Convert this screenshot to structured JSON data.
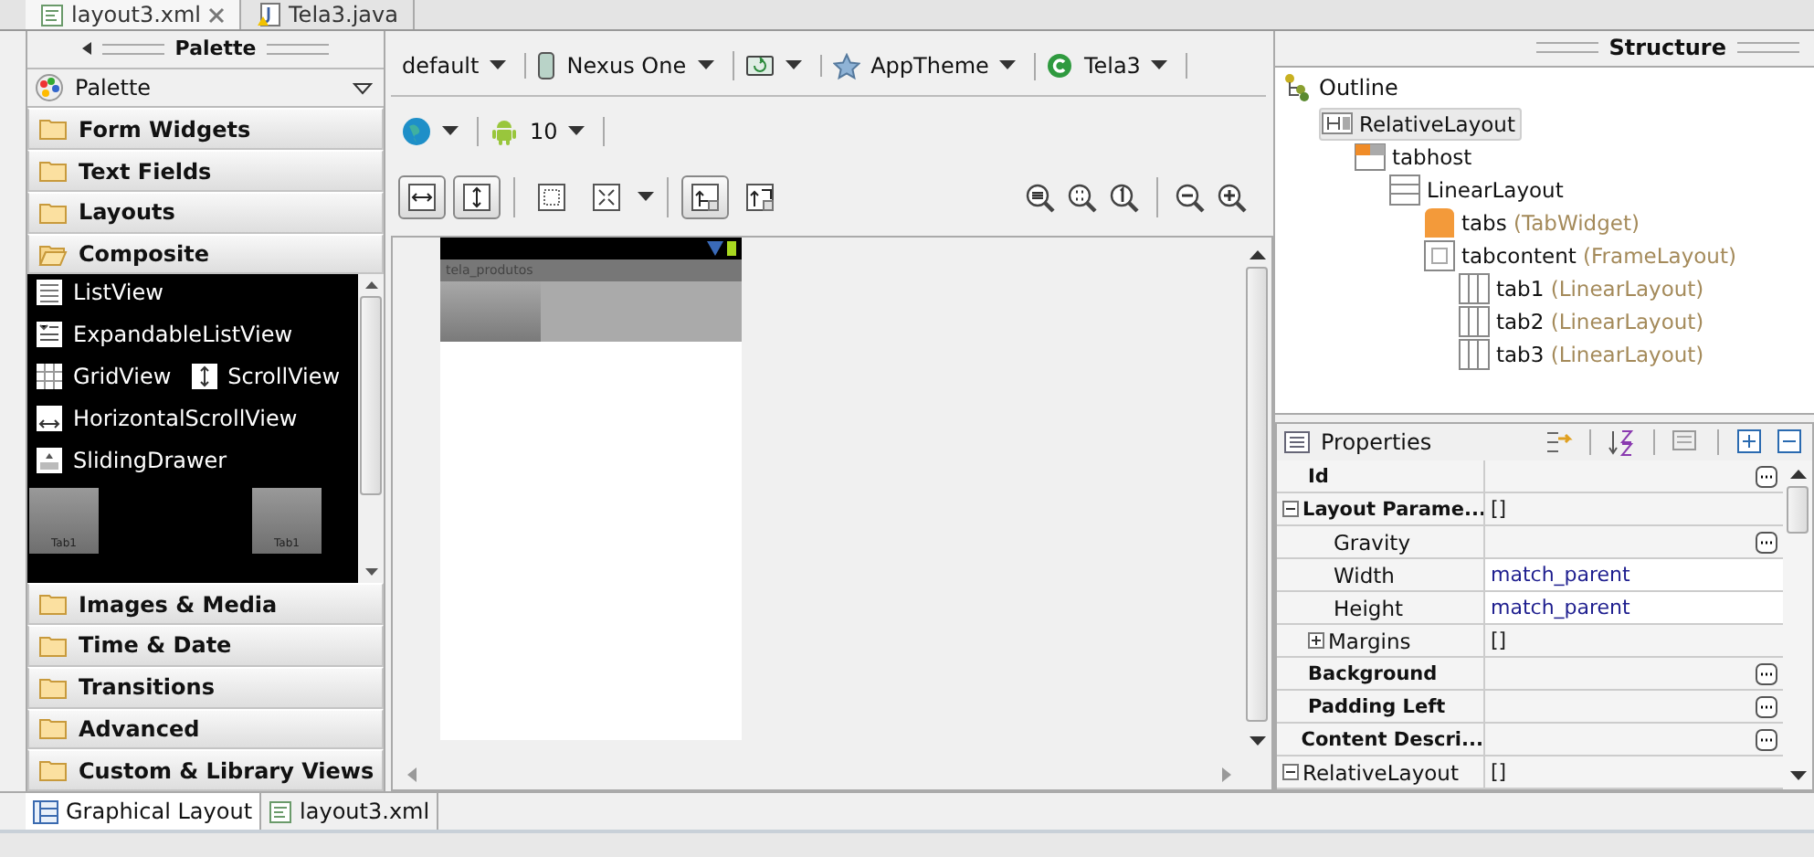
{
  "editor_tabs": [
    {
      "label": "layout3.xml",
      "selected": true,
      "kind": "xml"
    },
    {
      "label": "Tela3.java",
      "selected": false,
      "kind": "java"
    }
  ],
  "palette": {
    "title": "Palette",
    "dropdown": "Palette",
    "categories": [
      {
        "label": "Form Widgets",
        "expanded": false
      },
      {
        "label": "Text Fields",
        "expanded": false
      },
      {
        "label": "Layouts",
        "expanded": false
      },
      {
        "label": "Composite",
        "expanded": true,
        "widget_rows": [
          [
            {
              "label": "ListView",
              "kind": "list"
            }
          ],
          [
            {
              "label": "ExpandableListView",
              "kind": "expandable"
            }
          ],
          [
            {
              "label": "GridView",
              "kind": "grid"
            },
            {
              "label": "ScrollView",
              "kind": "vscroll"
            }
          ],
          [
            {
              "label": "HorizontalScrollView",
              "kind": "hscroll"
            }
          ],
          [
            {
              "label": "SlidingDrawer",
              "kind": "drawer"
            }
          ]
        ],
        "tab_preview": [
          "Tab1",
          "Tab1"
        ]
      },
      {
        "label": "Images & Media",
        "expanded": false
      },
      {
        "label": "Time & Date",
        "expanded": false
      },
      {
        "label": "Transitions",
        "expanded": false
      },
      {
        "label": "Advanced",
        "expanded": false
      },
      {
        "label": "Custom & Library Views",
        "expanded": false
      }
    ]
  },
  "config_bar": [
    {
      "kind": "text",
      "label": "default"
    },
    {
      "kind": "device",
      "label": "Nexus One"
    },
    {
      "kind": "orientation"
    },
    {
      "kind": "theme",
      "label": "AppTheme"
    },
    {
      "kind": "activity",
      "label": "Tela3"
    }
  ],
  "locale_bar": [
    {
      "kind": "globe"
    },
    {
      "kind": "android",
      "label": "10"
    }
  ],
  "layout_toggles": [
    {
      "kind": "fill-width",
      "on": true
    },
    {
      "kind": "fill-height",
      "on": true
    },
    {
      "kind": "margins",
      "on": false
    },
    {
      "kind": "resize",
      "on": false
    },
    {
      "kind": "layout-actions",
      "on": true
    },
    {
      "kind": "refresh",
      "on": false
    }
  ],
  "zoom_buttons": [
    {
      "kind": "fit"
    },
    {
      "kind": "real"
    },
    {
      "kind": "actual"
    },
    {
      "kind": "out"
    },
    {
      "kind": "in"
    }
  ],
  "preview": {
    "app_title": "tela_produtos"
  },
  "structure": {
    "title": "Structure",
    "outline_title": "Outline",
    "tree": [
      {
        "name": "RelativeLayout",
        "kind": "relative",
        "selected": true,
        "children": [
          {
            "name": "tabhost",
            "kind": "tabhost",
            "selected": false,
            "children": [
              {
                "name": "LinearLayout",
                "kind": "linear-v",
                "selected": false,
                "children": [
                  {
                    "name": "tabs",
                    "type": "(TabWidget)",
                    "kind": "tabwidget",
                    "selected": false
                  },
                  {
                    "name": "tabcontent",
                    "type": "(FrameLayout)",
                    "kind": "frame",
                    "selected": false,
                    "children": [
                      {
                        "name": "tab1",
                        "type": "(LinearLayout)",
                        "kind": "linear-h",
                        "selected": false
                      },
                      {
                        "name": "tab2",
                        "type": "(LinearLayout)",
                        "kind": "linear-h",
                        "selected": false
                      },
                      {
                        "name": "tab3",
                        "type": "(LinearLayout)",
                        "kind": "linear-h",
                        "selected": false
                      }
                    ]
                  }
                ]
              }
            ]
          }
        ]
      }
    ]
  },
  "properties": {
    "title": "Properties",
    "rows": [
      {
        "name": "Id",
        "bold": true,
        "modified": false,
        "has_editor": true
      },
      {
        "name": "Layout Parame...",
        "value": "[]",
        "bold": true,
        "modified": false,
        "has_editor": false,
        "expanded": true,
        "children": [
          {
            "name": "Gravity",
            "bold": false,
            "modified": false,
            "has_editor": true
          },
          {
            "name": "Width",
            "value": "match_parent",
            "bold": false,
            "modified": true,
            "has_editor": false
          },
          {
            "name": "Height",
            "value": "match_parent",
            "bold": false,
            "modified": true,
            "has_editor": false
          },
          {
            "name": "Margins",
            "value": "[]",
            "bold": false,
            "modified": false,
            "has_editor": false,
            "expanded": false
          }
        ]
      },
      {
        "name": "Background",
        "bold": true,
        "modified": false,
        "has_editor": true
      },
      {
        "name": "Padding Left",
        "bold": true,
        "modified": false,
        "has_editor": true
      },
      {
        "name": "Content Descri...",
        "bold": true,
        "modified": false,
        "has_editor": true
      },
      {
        "name": "RelativeLayout",
        "value": "[]",
        "bold": false,
        "modified": false,
        "has_editor": false,
        "expanded": true
      }
    ]
  },
  "bottom_tabs": [
    {
      "label": "Graphical Layout",
      "selected": true,
      "kind": "layout"
    },
    {
      "label": "layout3.xml",
      "selected": false,
      "kind": "xml"
    }
  ]
}
